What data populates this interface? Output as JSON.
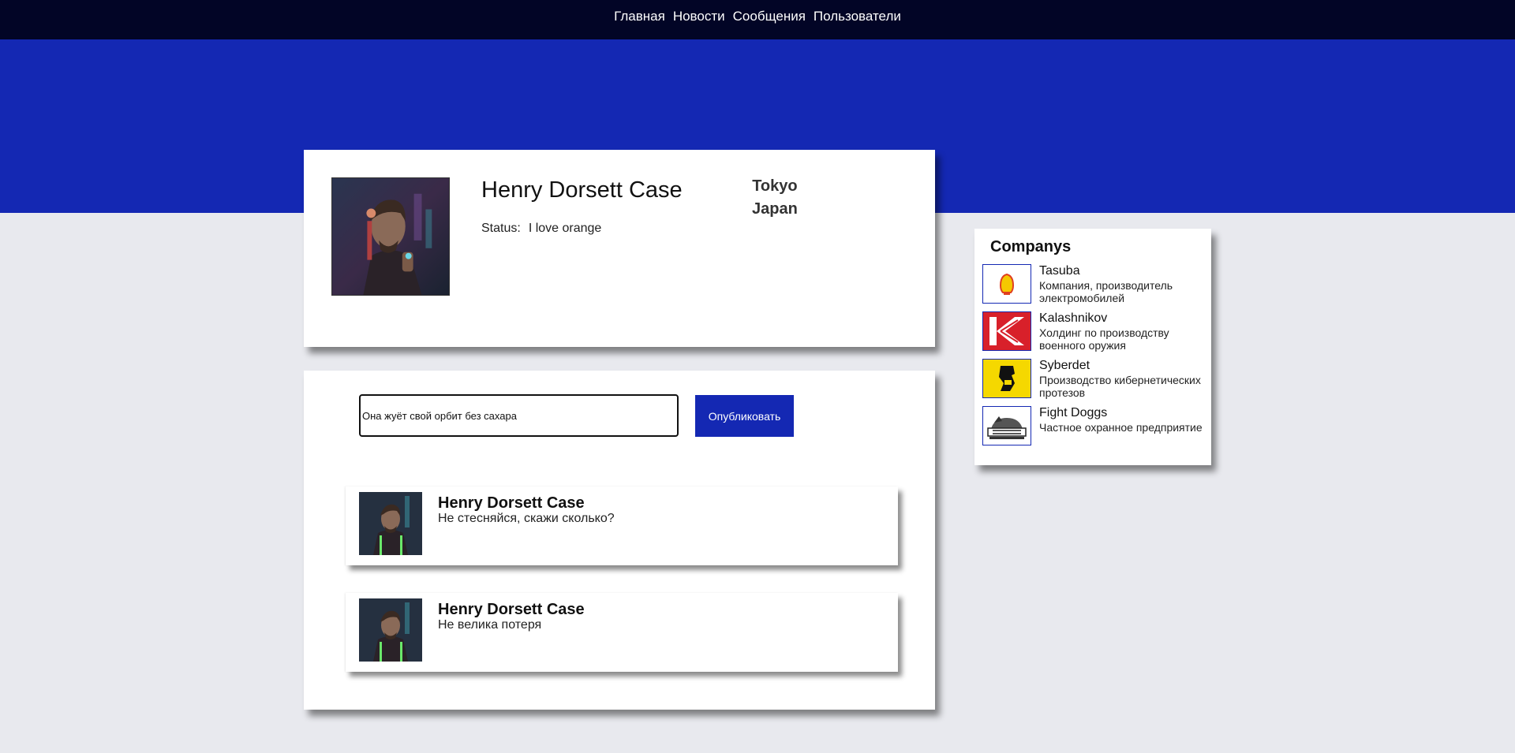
{
  "nav": {
    "items": [
      {
        "label": "Главная"
      },
      {
        "label": "Новости"
      },
      {
        "label": "Сообщения"
      },
      {
        "label": "Пользователи"
      }
    ]
  },
  "profile": {
    "name": "Henry Dorsett Case",
    "status_label": "Status:",
    "status": "I love orange",
    "city": "Tokyo",
    "country": "Japan",
    "avatar_icon": "avatar-portrait-icon"
  },
  "composer": {
    "value": "Она жуёт свой орбит без сахара",
    "publish_label": "Опубликовать"
  },
  "posts": [
    {
      "author": "Henry Dorsett Case",
      "text": "Не стесняйся, скажи сколько?"
    },
    {
      "author": "Henry Dorsett Case",
      "text": "Не велика потеря"
    }
  ],
  "companies": {
    "title": "Companys",
    "items": [
      {
        "name": "Tasuba",
        "desc": "Компания, производитель электромобилей",
        "icon": "shell-logo-icon"
      },
      {
        "name": "Kalashnikov",
        "desc": "Холдинг по производству военного оружия",
        "icon": "k-logo-icon"
      },
      {
        "name": "Syberdet",
        "desc": "Производство кибернетических протезов",
        "icon": "cyber-logo-icon"
      },
      {
        "name": "Fight Doggs",
        "desc": "Частное охранное предприятие",
        "icon": "top-dog-logo-icon"
      }
    ]
  },
  "colors": {
    "nav_bg": "#020526",
    "accent": "#1428b3",
    "page_bg": "#e8e9ee"
  }
}
